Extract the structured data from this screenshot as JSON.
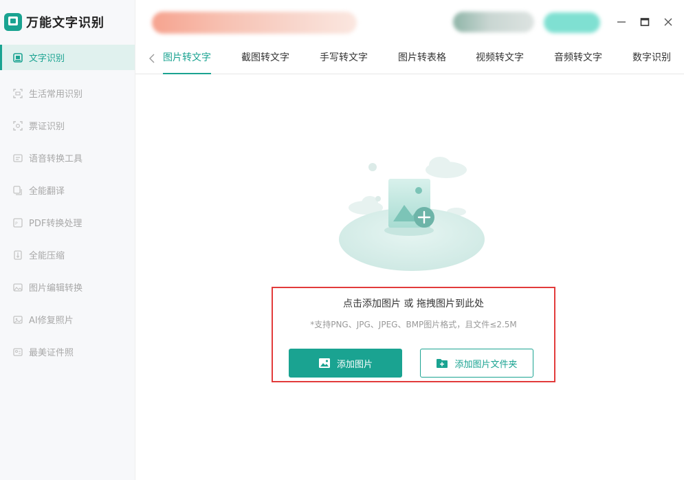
{
  "app": {
    "title": "万能文字识别"
  },
  "sidebar": {
    "items": [
      {
        "label": "文字识别",
        "icon": "text-recognition-icon",
        "active": true
      },
      {
        "label": "生活常用识别",
        "icon": "scan-icon",
        "active": false
      },
      {
        "label": "票证识别",
        "icon": "ticket-scan-icon",
        "active": false
      },
      {
        "label": "语音转换工具",
        "icon": "voice-convert-icon",
        "active": false
      },
      {
        "label": "全能翻译",
        "icon": "translate-icon",
        "active": false
      },
      {
        "label": "PDF转换处理",
        "icon": "pdf-icon",
        "active": false
      },
      {
        "label": "全能压缩",
        "icon": "compress-icon",
        "active": false
      },
      {
        "label": "图片编辑转换",
        "icon": "image-edit-icon",
        "active": false
      },
      {
        "label": "AI修复照片",
        "icon": "ai-repair-icon",
        "active": false
      },
      {
        "label": "最美证件照",
        "icon": "id-photo-icon",
        "active": false
      }
    ]
  },
  "tabs": [
    {
      "label": "图片转文字",
      "active": true
    },
    {
      "label": "截图转文字",
      "active": false
    },
    {
      "label": "手写转文字",
      "active": false
    },
    {
      "label": "图片转表格",
      "active": false
    },
    {
      "label": "视频转文字",
      "active": false
    },
    {
      "label": "音频转文字",
      "active": false
    },
    {
      "label": "数字识别",
      "active": false
    }
  ],
  "upload": {
    "title": "点击添加图片 或 拖拽图片到此处",
    "hint": "*支持PNG、JPG、JPEG、BMP图片格式，且文件≤2.5M",
    "add_image_label": "添加图片",
    "add_folder_label": "添加图片文件夹"
  },
  "colors": {
    "accent": "#1aa391",
    "accent_light": "#e0f1ee",
    "highlight_border": "#e23a3a"
  }
}
